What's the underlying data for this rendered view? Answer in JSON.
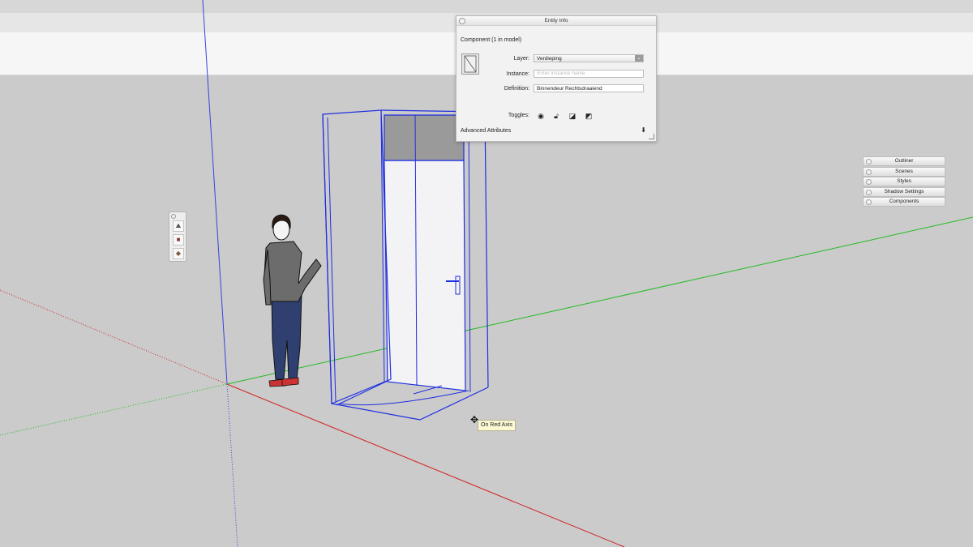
{
  "entity_info": {
    "title": "Entity Info",
    "component_header": "Component (1 in model)",
    "layer_label": "Layer:",
    "layer_value": "Verdieping",
    "instance_label": "Instance:",
    "instance_placeholder": "Enter instance name",
    "definition_label": "Definition:",
    "definition_value": "Binnendeur Rechtsdraaiend",
    "toggles_label": "Toggles:",
    "advanced_label": "Advanced Attributes",
    "toggle_icons": [
      "eye-icon",
      "lock-icon",
      "cast-shadows-icon",
      "receive-shadows-icon"
    ]
  },
  "tray": {
    "items": [
      "Outliner",
      "Scenes",
      "Styles",
      "Shadow Settings",
      "Components"
    ]
  },
  "mini_toolbar": {
    "icons": [
      "walk-icon",
      "component-icon",
      "material-icon"
    ]
  },
  "tooltip": {
    "text": "On Red Axis"
  },
  "colors": {
    "background": "#cbcbcb",
    "selection_blue": "#1f2ee0",
    "red_axis": "#d22222",
    "green_axis": "#22bb22",
    "blue_axis": "#3344dd",
    "tooltip_bg": "#fbf8d4"
  }
}
